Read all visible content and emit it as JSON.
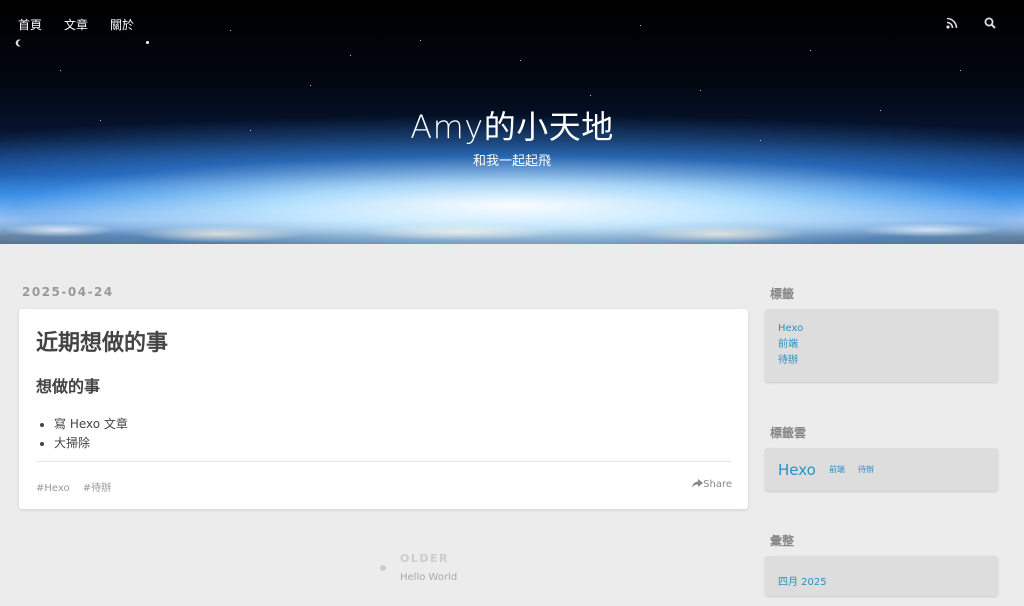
{
  "nav": {
    "items": [
      "首頁",
      "文章",
      "關於"
    ],
    "icons": [
      "rss-icon",
      "search-icon"
    ]
  },
  "header": {
    "title": "Amy的小天地",
    "subtitle": "和我一起起飛"
  },
  "post": {
    "date": "2025-04-24",
    "title": "近期想做的事",
    "subheading": "想做的事",
    "list": [
      "寫 Hexo 文章",
      "大掃除"
    ],
    "tags": [
      "#Hexo",
      "#待辦"
    ],
    "share_label": "Share"
  },
  "pagination": {
    "label": "OLDER",
    "title": "Hello World"
  },
  "sidebar": {
    "tags": {
      "title": "標籤",
      "items": [
        "Hexo",
        "前端",
        "待辦"
      ]
    },
    "tagcloud": {
      "title": "標籤雲",
      "items": [
        "Hexo",
        "前端",
        "待辦"
      ]
    },
    "archive": {
      "title": "彙整",
      "items": [
        "四月 2025"
      ]
    }
  },
  "colors": {
    "link": "#2a90c0",
    "background": "#ececec"
  }
}
